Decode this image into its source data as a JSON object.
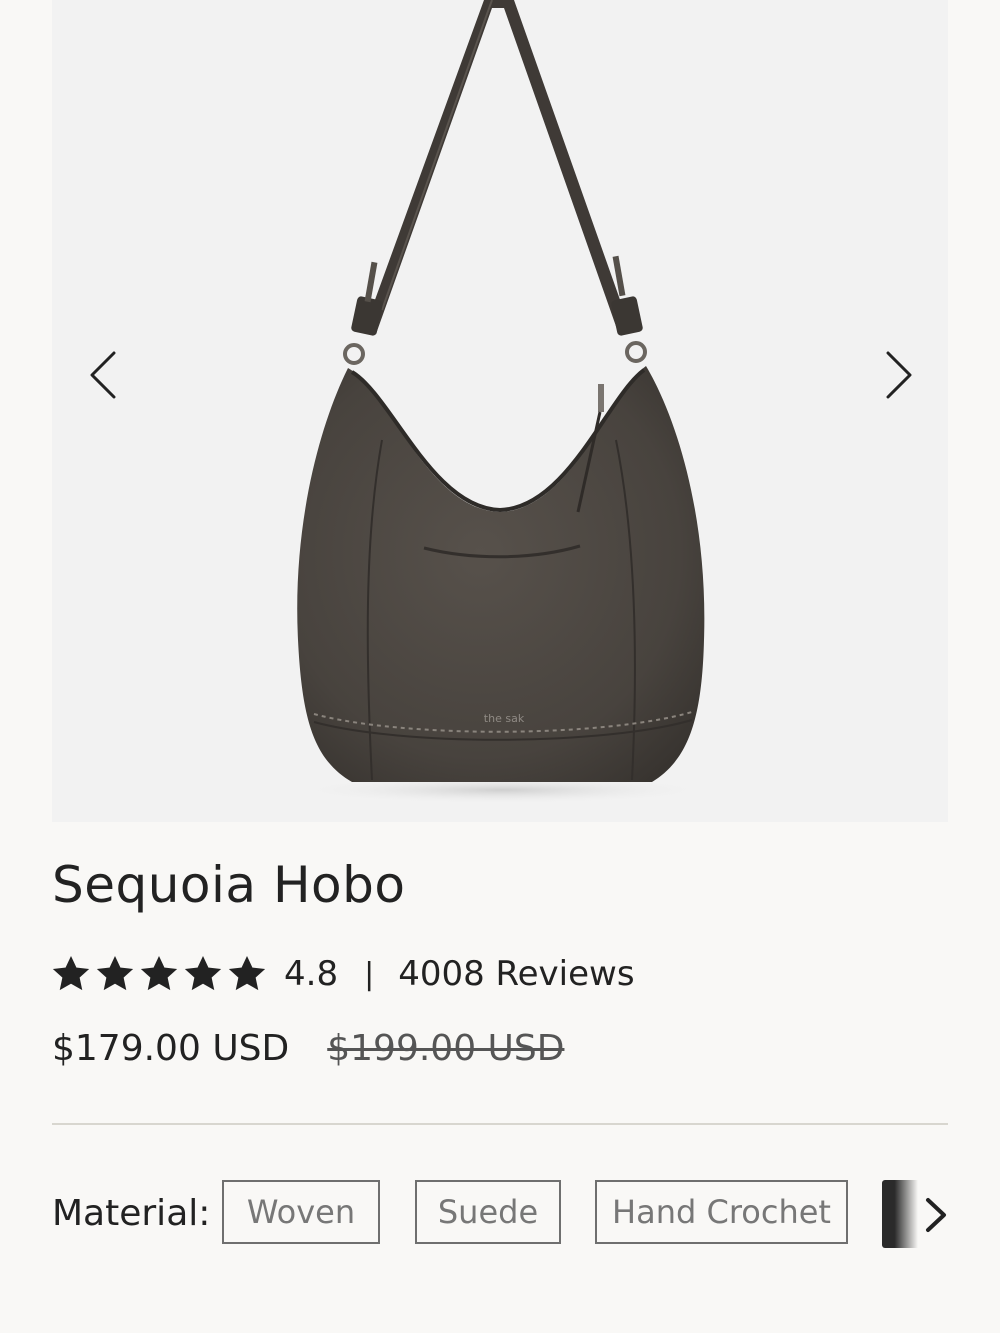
{
  "product": {
    "title": "Sequoia Hobo",
    "rating": "4.8",
    "stars_filled": 5,
    "reviews": "4008 Reviews",
    "price": "$179.00 USD",
    "compare_price": "$199.00 USD"
  },
  "gallery": {
    "prev_icon": "chevron-left-icon",
    "next_icon": "chevron-right-icon",
    "bag_brand_mark": "the sak"
  },
  "material": {
    "label": "Material:",
    "options": [
      "Woven",
      "Suede",
      "Hand Crochet"
    ],
    "scroll_icon": "chevron-right-icon"
  },
  "colors": {
    "background": "#f9f8f6",
    "gallery_bg": "#f2f2f2",
    "text": "#222222",
    "bag": "#4a4540"
  }
}
